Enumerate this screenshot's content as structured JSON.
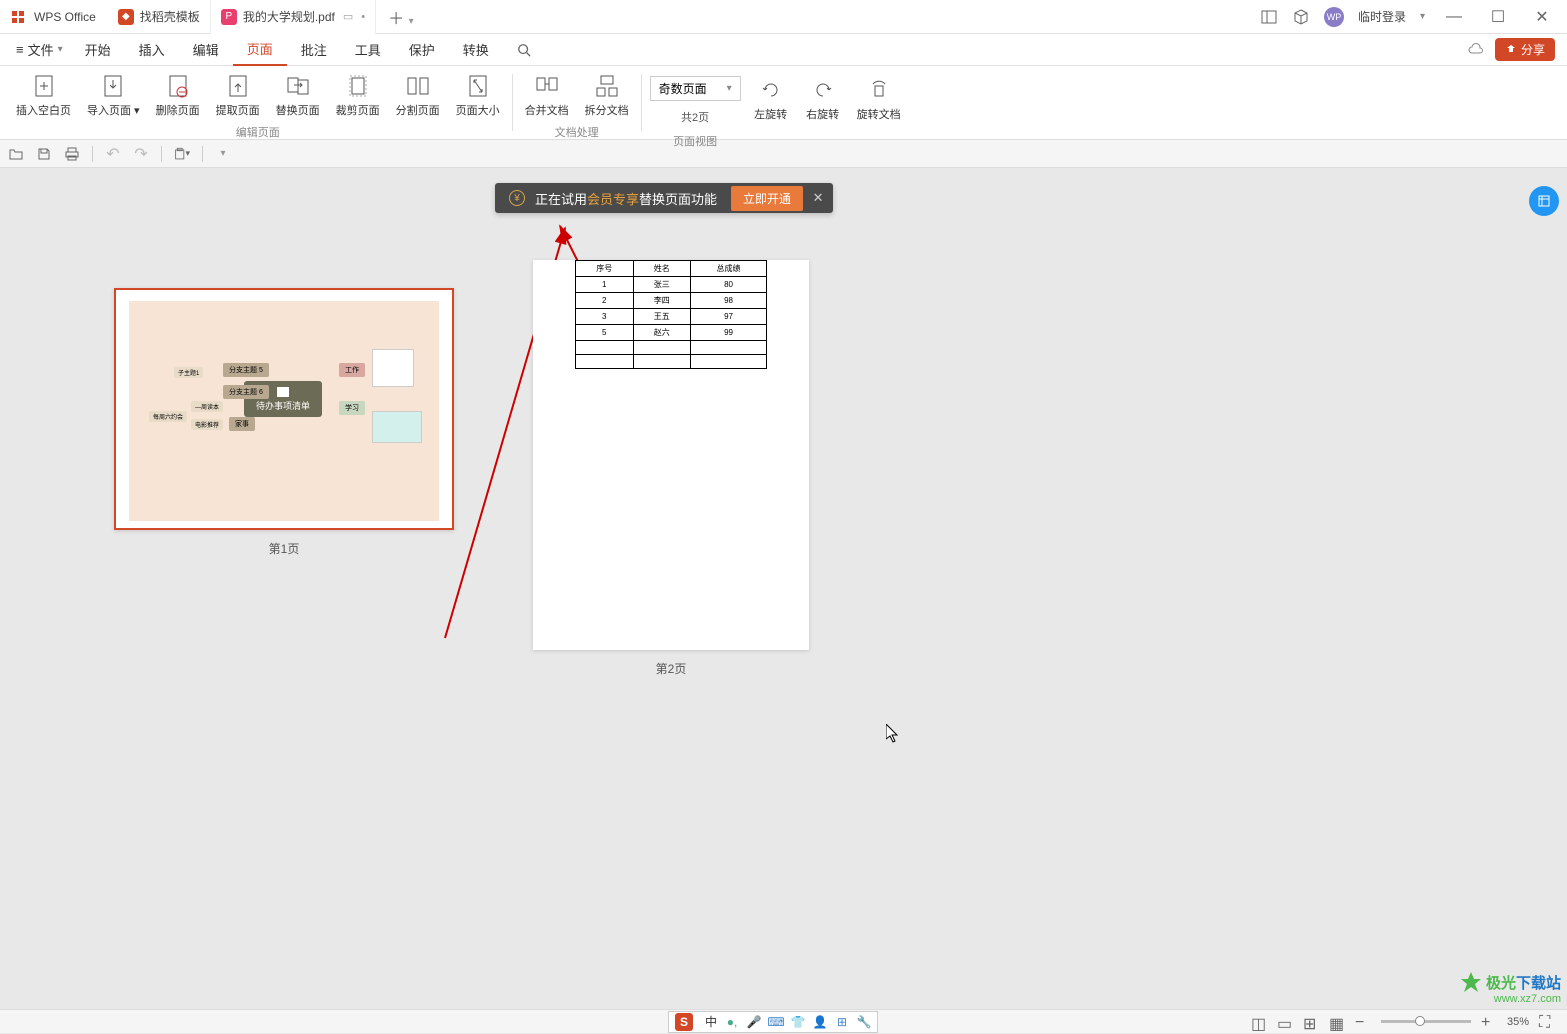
{
  "app": {
    "name": "WPS Office"
  },
  "tabs": [
    {
      "label": "找稻壳模板",
      "icon": "red"
    },
    {
      "label": "我的大学规划.pdf",
      "icon": "pink",
      "active": true
    }
  ],
  "titlebar": {
    "login": "临时登录"
  },
  "file_menu": "文件",
  "menus": [
    "开始",
    "插入",
    "编辑",
    "页面",
    "批注",
    "工具",
    "保护",
    "转换"
  ],
  "active_menu": "页面",
  "share_btn": "分享",
  "ribbon": {
    "g1": {
      "label": "编辑页面",
      "buttons": [
        "插入空白页",
        "导入页面",
        "删除页面",
        "提取页面",
        "替换页面",
        "裁剪页面",
        "分割页面",
        "页面大小"
      ]
    },
    "g2": {
      "label": "文档处理",
      "buttons": [
        "合并文档",
        "拆分文档"
      ]
    },
    "g3": {
      "label": "页面视图",
      "dropdown": "奇数页面",
      "page_count": "共2页",
      "buttons": [
        "左旋转",
        "右旋转",
        "旋转文档"
      ]
    }
  },
  "banner": {
    "prefix": "正在试用",
    "highlight": "会员专享",
    "suffix": "替换页面功能",
    "button": "立即开通"
  },
  "pages": {
    "p1_label": "第1页",
    "p2_label": "第2页",
    "mindmap_center": "待办事项清单",
    "mm_nodes": {
      "sub_topic_5": "分支主题 5",
      "sub_topic_6": "分支主题 6",
      "work": "工作",
      "study": "学习",
      "home": "家事",
      "child": "子主题1",
      "sub1": "每周六约会",
      "sub2": "—周读本",
      "sub3": "电影推荐"
    }
  },
  "chart_data": {
    "type": "table",
    "headers": [
      "序号",
      "姓名",
      "总成绩"
    ],
    "rows": [
      [
        "1",
        "张三",
        "80"
      ],
      [
        "2",
        "李四",
        "98"
      ],
      [
        "3",
        "王五",
        "97"
      ],
      [
        "5",
        "赵六",
        "99"
      ],
      [
        "",
        "",
        ""
      ],
      [
        "",
        "",
        ""
      ]
    ]
  },
  "zoom": "35%",
  "watermark": {
    "brand_prefix": "极光",
    "brand_suffix": "下载站",
    "url": "www.xz7.com"
  },
  "ime": {
    "lang": "中"
  }
}
